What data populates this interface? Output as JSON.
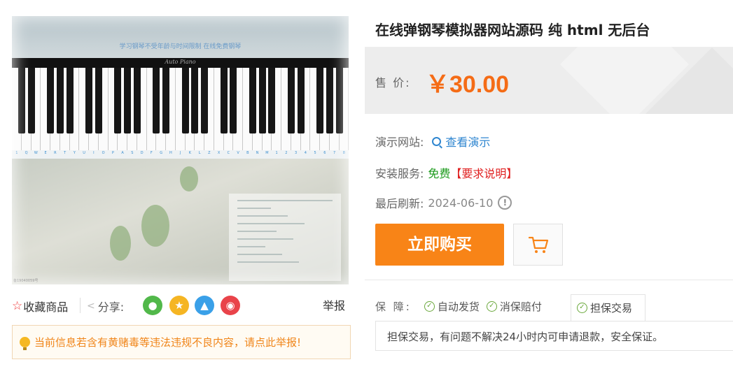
{
  "preview": {
    "site_title": "学习钢琴不受年龄与时间限制 在线免费钢琴",
    "brand": "Auto Piano",
    "key_labels": [
      "1",
      "Q",
      "W",
      "E",
      "R",
      "T",
      "Y",
      "U",
      "I",
      "O",
      "P",
      "A",
      "S",
      "D",
      "F",
      "G",
      "H",
      "J",
      "K",
      "L",
      "Z",
      "X",
      "C",
      "V",
      "B",
      "N",
      "M",
      "1",
      "2",
      "3",
      "4",
      "5",
      "6",
      "7",
      "8"
    ],
    "copyright": "备19040059号"
  },
  "actions": {
    "favorite": "收藏商品",
    "share": "分享:",
    "report": "举报"
  },
  "warning": "当前信息若含有黄赌毒等违法违规不良内容，请点此举报!",
  "product": {
    "title": "在线弹钢琴模拟器网站源码 纯 html 无后台",
    "price_label": "售 价:",
    "price": "￥30.00",
    "demo_label": "演示网站:",
    "demo_link": "查看演示",
    "install_label": "安装服务:",
    "install_free": "免费",
    "install_req": "【要求说明】",
    "refresh_label": "最后刷新:",
    "refresh_date": "2024-06-10",
    "buy_button": "立即购买"
  },
  "guarantee": {
    "label": "保 障:",
    "items": [
      "自动发货",
      "消保赔付",
      "担保交易"
    ],
    "description": "担保交易，有问题不解决24小时内可申请退款，安全保证。"
  },
  "colors": {
    "price": "#f56c16",
    "buy": "#f88417",
    "link": "#2f86d0",
    "free": "#1a9a1a",
    "req": "#e02020",
    "warning": "#f08519"
  }
}
